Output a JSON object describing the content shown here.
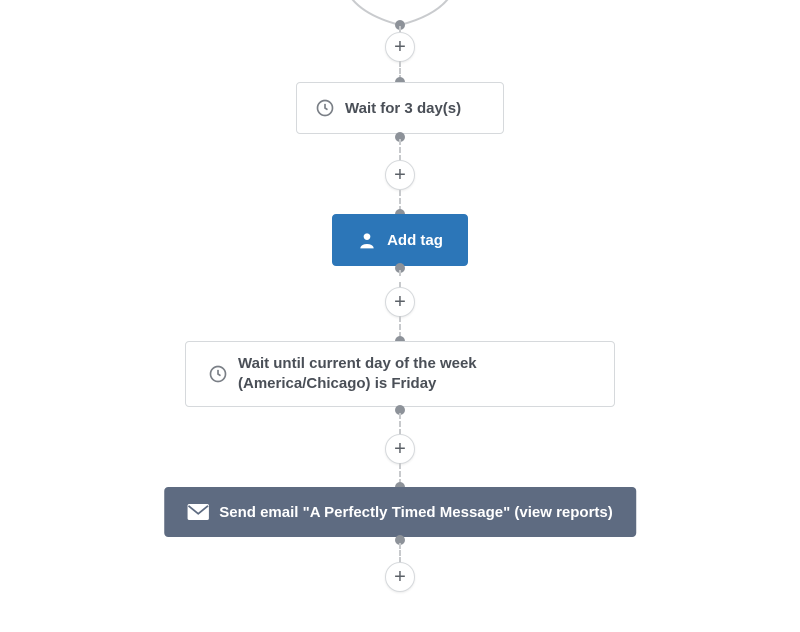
{
  "nodes": {
    "wait1": {
      "label": "Wait for 3 day(s)"
    },
    "addTag": {
      "label": "Add tag"
    },
    "wait2": {
      "label": "Wait until current day of the week (America/Chicago) is Friday"
    },
    "sendEmail": {
      "label": "Send email \"A Perfectly Timed Message\" (view reports)"
    }
  }
}
